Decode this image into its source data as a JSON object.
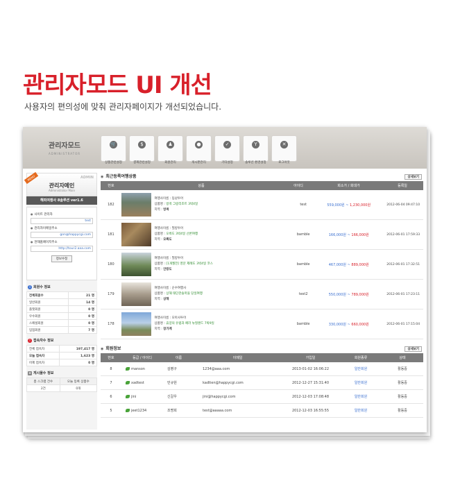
{
  "hero": {
    "title": "관리자모드 UI 개선",
    "subtitle": "사용자의 편의성에 맞춰 관리자페이지가 개선되었습니다."
  },
  "header": {
    "title": "관리자모드",
    "subtitle": "ADMINISTRATOR"
  },
  "nav": [
    {
      "label": "상품관련설정",
      "icon": "cart-icon"
    },
    {
      "label": "결제관련설정",
      "icon": "money-bag-icon"
    },
    {
      "label": "회원관리",
      "icon": "members-icon"
    },
    {
      "label": "게시판관리",
      "icon": "speech-bubble-icon"
    },
    {
      "label": "기타설정",
      "icon": "check-icon"
    },
    {
      "label": "솔루션 환경설정",
      "icon": "wrench-icon"
    },
    {
      "label": "로그아웃",
      "icon": "close-icon"
    }
  ],
  "sidebar": {
    "ribbon": "MENU",
    "admin_label": "ADMIN",
    "profile_title": "관리자메인",
    "profile_sub": "Administrator Main",
    "version": "해피여행사 8솔루션 ver1.6",
    "site": {
      "fields": [
        {
          "label": "사이트 관리자",
          "value": "test"
        },
        {
          "label": "관리자이메일주소",
          "value": "gon@happycgi.com"
        },
        {
          "label": "현재홈페이지주소",
          "value": "http://tour2.aaa.com"
        }
      ],
      "save_label": "정보수정"
    },
    "members": {
      "title": "회원수 정보",
      "rows": [
        {
          "label": "전체회원수",
          "value": "21 명"
        },
        {
          "label": "일반회원",
          "value": "14 명"
        },
        {
          "label": "플랫회원",
          "value": "0 명"
        },
        {
          "label": "우수회원",
          "value": "0 명"
        },
        {
          "label": "스페셜회원",
          "value": "0 명"
        },
        {
          "label": "입점회원",
          "value": "7 명"
        }
      ]
    },
    "visitors": {
      "title": "접속자수 정보",
      "rows": [
        {
          "label": "전체 접속자",
          "value": "197,417 명"
        },
        {
          "label": "오늘 접속자",
          "value": "1,623 명"
        },
        {
          "label": "어제 접속자",
          "value": "0 명"
        }
      ]
    },
    "boards": {
      "title": "게시물수 정보",
      "headers": [
        "총 스크랩 건수",
        "오늘 등록 상품수"
      ],
      "partial": [
        "2건",
        "0개"
      ]
    }
  },
  "products": {
    "title": "최근등록여행상품",
    "more_label": "상세보기",
    "columns": [
      "번호",
      "상품",
      "아이디",
      "회소가 / 회대가",
      "등록일"
    ],
    "rows": [
      {
        "num": "182",
        "company": "여행사이름 : 동남투어",
        "name_label": "상품명 : ",
        "name": "방콕 그랑리조트 3박4일",
        "region_label": "지역 : ",
        "region": "방콕",
        "id": "test",
        "price": "559,000원",
        "price2": "1,230,000원",
        "date": "2012-06-04 09:47:10"
      },
      {
        "num": "181",
        "company": "여행사이름 : 필방투어",
        "name_label": "상품명 : ",
        "name": "오륙도 3박4일 선론여행",
        "region_label": "지역 : ",
        "region": "오륙도",
        "id": "bamble",
        "price": "166,000원",
        "price2": "166,000원",
        "date": "2012-06-01 17:59:33"
      },
      {
        "num": "180",
        "company": "여행사이름 : 필방투어",
        "name_label": "상품명 : ",
        "name": "[1개월전] 영문 제례도 3박4일 코스",
        "region_label": "지역 : ",
        "region": "안랑도",
        "id": "bamble",
        "price": "467,000원",
        "price2": "889,000원",
        "date": "2012-06-01 17:32:51"
      },
      {
        "num": "179",
        "company": "여행사이름 : 순수여행사",
        "name_label": "상품명 : ",
        "name": "상해 태단관솔마을 당일여행",
        "region_label": "지역 : ",
        "region": "상해",
        "id": "test2",
        "price": "550,000원",
        "price2": "789,000원",
        "date": "2012-06-01 17:23:11"
      },
      {
        "num": "178",
        "company": "여행사이름 : 모아사투어",
        "name_label": "상품명 : ",
        "name": "휴양의 유럽과 페라 뉴질랜드 7박9일",
        "region_label": "지역 : ",
        "region": "장가계",
        "id": "bamble",
        "price": "330,000원",
        "price2": "660,000원",
        "date": "2012-06-01 17:15:04"
      }
    ]
  },
  "members_list": {
    "title": "회원정보",
    "more_label": "상세보기",
    "columns": [
      "번호",
      "등급 / 아이디",
      "이름",
      "이메일",
      "가입일",
      "회원종류",
      "상태"
    ],
    "rows": [
      {
        "num": "8",
        "id": "manson",
        "name": "김병구",
        "email": "1234@aaa.com",
        "date": "2013-01-02 16:06:22",
        "type": "일반회원",
        "status": "활동중"
      },
      {
        "num": "7",
        "id": "xadtest",
        "name": "민규원",
        "email": "kadtien@happycgi.com",
        "date": "2012-12-27 15:31:40",
        "type": "일반회원",
        "status": "활동중"
      },
      {
        "num": "6",
        "id": "jini",
        "name": "신갈우",
        "email": "jini@happycgi.com",
        "date": "2012-12-03 17:08:48",
        "type": "일반회원",
        "status": "활동중"
      },
      {
        "num": "5",
        "id": "jeet1234",
        "name": "조명희",
        "email": "test@aaaaa.com",
        "date": "2012-12-03 16:55:55",
        "type": "일반회원",
        "status": "활동중"
      }
    ]
  }
}
